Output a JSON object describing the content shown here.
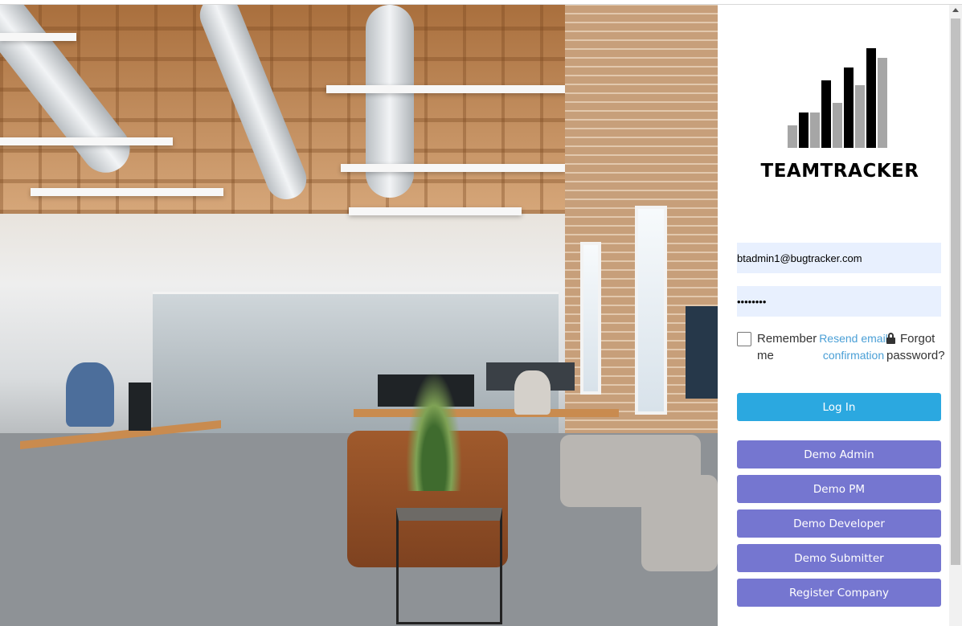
{
  "brand": {
    "name": "TEAMTRACKER",
    "bar_colors": [
      "#000000",
      "#a6a6a6"
    ]
  },
  "login": {
    "email_value": "btadmin1@bugtracker.com",
    "password_value": "••••••••",
    "remember_label": "Remember me",
    "resend_label": "Resend email confirmation",
    "forgot_label": "Forgot password?",
    "lock_icon": "lock-icon",
    "login_button": "Log In"
  },
  "demo_buttons": [
    {
      "label": "Demo Admin"
    },
    {
      "label": "Demo PM"
    },
    {
      "label": "Demo Developer"
    },
    {
      "label": "Demo Submitter"
    },
    {
      "label": "Register Company"
    }
  ],
  "colors": {
    "login_button": "#2ba8e0",
    "demo_button": "#7576d0",
    "link": "#4a9fd6",
    "input_background": "#e8f0fe"
  }
}
